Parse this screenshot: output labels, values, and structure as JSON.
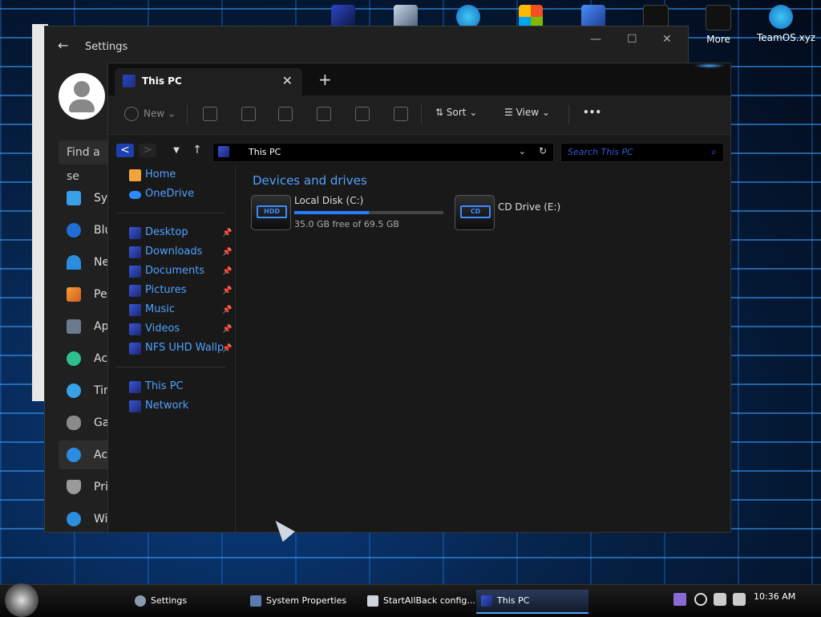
{
  "desktop": {
    "icons": [
      {
        "label": ""
      },
      {
        "label": ""
      },
      {
        "label": ""
      },
      {
        "label": ""
      },
      {
        "label": ""
      },
      {
        "label": ""
      },
      {
        "label": "More"
      },
      {
        "label": "TeamOS.xyz"
      }
    ]
  },
  "settings": {
    "title": "Settings",
    "search_placeholder": "Find a se",
    "nav": [
      {
        "label": "Sys",
        "icon": "monitor-icon"
      },
      {
        "label": "Blu",
        "icon": "bluetooth-icon"
      },
      {
        "label": "Ne",
        "icon": "wifi-icon"
      },
      {
        "label": "Per",
        "icon": "brush-icon"
      },
      {
        "label": "Ap",
        "icon": "apps-icon"
      },
      {
        "label": "Acc",
        "icon": "person-icon"
      },
      {
        "label": "Tin",
        "icon": "clock-icon"
      },
      {
        "label": "Ga",
        "icon": "gamepad-icon"
      },
      {
        "label": "Acc",
        "icon": "accessibility-icon"
      },
      {
        "label": "Priv",
        "icon": "shield-icon"
      },
      {
        "label": "Wi",
        "icon": "update-icon"
      }
    ]
  },
  "explorer": {
    "tab_title": "This PC",
    "toolbar": {
      "new_label": "New",
      "sort_label": "Sort",
      "view_label": "View",
      "more_label": "•••"
    },
    "address": "This PC",
    "search_placeholder": "Search This PC",
    "sidebar": {
      "top": [
        {
          "label": "Home"
        },
        {
          "label": "OneDrive"
        }
      ],
      "pinned": [
        {
          "label": "Desktop"
        },
        {
          "label": "Downloads"
        },
        {
          "label": "Documents"
        },
        {
          "label": "Pictures"
        },
        {
          "label": "Music"
        },
        {
          "label": "Videos"
        },
        {
          "label": "NFS UHD Wallp"
        }
      ],
      "bottom": [
        {
          "label": "This PC"
        },
        {
          "label": "Network"
        }
      ]
    },
    "section_title": "Devices and drives",
    "drives": [
      {
        "name": "Local Disk (C:)",
        "badge": "HDD",
        "free_text": "35.0 GB free of 69.5 GB",
        "used_fraction": 0.5
      },
      {
        "name": "CD Drive (E:)",
        "badge": "CD",
        "free_text": "",
        "used_fraction": null
      }
    ]
  },
  "taskbar": {
    "items": [
      {
        "label": "Settings"
      },
      {
        "label": "System Properties"
      },
      {
        "label": "StartAllBack config..."
      },
      {
        "label": "This PC"
      }
    ],
    "clock": "10:36 AM"
  },
  "colors": {
    "accent": "#4ea2ff",
    "window_bg": "#191919"
  }
}
